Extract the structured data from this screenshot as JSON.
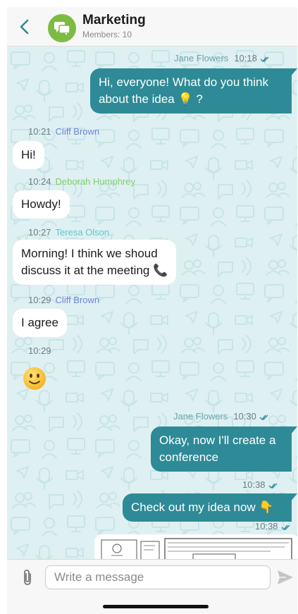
{
  "header": {
    "title": "Marketing",
    "members": "Members: 10",
    "back_icon": "chevron-left-icon",
    "avatar_icon": "chat-group-icon",
    "avatar_color": "#7dbb42",
    "accent": "#2e8a96"
  },
  "messages": [
    {
      "direction": "out",
      "sender": "Jane Flowers",
      "time": "10:18",
      "lines": [
        "Hi, everyone! What do you think",
        "about the idea 💡 ?"
      ]
    },
    {
      "direction": "in",
      "sender": "Cliff Brown",
      "time": "10:21",
      "lines": [
        "Hi!"
      ],
      "sender_color": "#6a86d8"
    },
    {
      "direction": "in",
      "sender": "Deborah Humphrey",
      "time": "10:24",
      "lines": [
        "Howdy!"
      ],
      "sender_color": "#7ecf6a"
    },
    {
      "direction": "in",
      "sender": "Teresa Olson",
      "time": "10:27",
      "lines": [
        "Morning! I think we shoud",
        "discuss it at the meeting 📞"
      ],
      "sender_color": "#5cc7c9"
    },
    {
      "direction": "in",
      "sender": "Cliff Brown",
      "time": "10:29",
      "lines": [
        "I agree"
      ],
      "sender_color": "#6a86d8"
    },
    {
      "direction": "in",
      "sender": "",
      "time": "10:29",
      "lines": [],
      "emoji": "slightly-smiling-face-icon"
    },
    {
      "direction": "out",
      "sender": "Jane Flowers",
      "time": "10:30",
      "lines": [
        "Okay, now I'll create a",
        "conference"
      ]
    },
    {
      "direction": "out",
      "sender": "",
      "time": "10:38",
      "lines": [
        "Check out my idea now 👇"
      ]
    },
    {
      "direction": "out",
      "sender": "",
      "time": "10:38",
      "lines": [],
      "attachment": "image-preview"
    }
  ],
  "composer": {
    "placeholder": "Write a message",
    "attach_icon": "paperclip-icon",
    "send_icon": "send-icon"
  }
}
